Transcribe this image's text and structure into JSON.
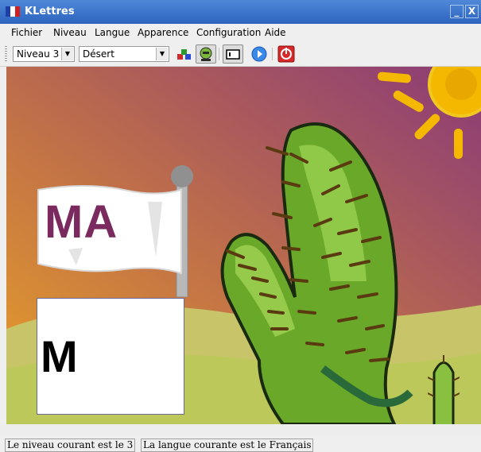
{
  "window": {
    "title": "KLettres",
    "minimize_symbol": "_",
    "close_symbol": "X"
  },
  "menubar": {
    "items": [
      "Fichier",
      "Niveau",
      "Langue",
      "Apparence",
      "Configuration",
      "Aide"
    ]
  },
  "toolbar": {
    "level_combo": "Niveau 3",
    "theme_combo": "Désert",
    "buttons": [
      "grownup-kid-icon",
      "kid-icon",
      "show-menubar-icon",
      "hint-icon",
      "quit-icon"
    ]
  },
  "game": {
    "flag_letters": "MA",
    "typed_letter": "M"
  },
  "statusbar": {
    "level_text": "Le niveau courant est le 3",
    "language_text": "La langue courante est le Français"
  },
  "colors": {
    "title_bar": "#3a74cc",
    "flag_text": "#7a2a5e",
    "sun": "#f5b800",
    "cactus": "#6aa82a"
  }
}
